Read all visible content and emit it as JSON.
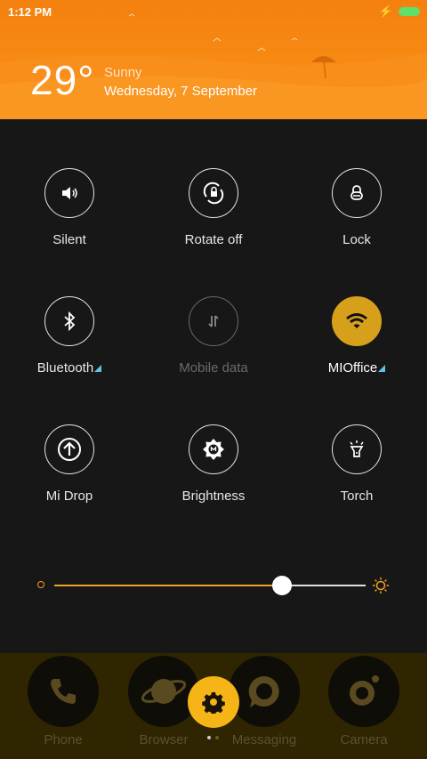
{
  "status_bar": {
    "time": "1:12 PM",
    "icons": [
      "charging-bolt-icon",
      "battery-icon"
    ]
  },
  "weather": {
    "temperature": "29°",
    "condition": "Sunny",
    "date": "Wednesday, 7 September"
  },
  "quick_toggles": [
    {
      "label": "Silent",
      "icon": "speaker-icon",
      "state": "off",
      "has_settings_corner": false
    },
    {
      "label": "Rotate off",
      "icon": "rotate-lock-icon",
      "state": "off",
      "has_settings_corner": false
    },
    {
      "label": "Lock",
      "icon": "lock-icon",
      "state": "off",
      "has_settings_corner": false
    },
    {
      "label": "Bluetooth",
      "icon": "bluetooth-icon",
      "state": "off",
      "has_settings_corner": true
    },
    {
      "label": "Mobile data",
      "icon": "mobile-data-icon",
      "state": "disabled",
      "has_settings_corner": false
    },
    {
      "label": "MIOffice",
      "icon": "wifi-icon",
      "state": "on",
      "has_settings_corner": true
    },
    {
      "label": "Mi Drop",
      "icon": "upload-icon",
      "state": "off",
      "has_settings_corner": false
    },
    {
      "label": "Brightness",
      "icon": "brightness-auto-icon",
      "state": "off",
      "has_settings_corner": false
    },
    {
      "label": "Torch",
      "icon": "torch-icon",
      "state": "off",
      "has_settings_corner": false
    }
  ],
  "brightness": {
    "level": 0.73,
    "min_icon": "brightness-low-icon",
    "max_icon": "brightness-high-icon"
  },
  "dock": {
    "apps": [
      {
        "label": "Phone",
        "icon": "phone-icon"
      },
      {
        "label": "Browser",
        "icon": "browser-icon"
      },
      {
        "label": "Messaging",
        "icon": "messaging-icon"
      },
      {
        "label": "Camera",
        "icon": "camera-icon"
      }
    ],
    "settings_icon": "gear-icon",
    "page_dots": 2,
    "active_page": 0
  },
  "colors": {
    "header": "#f68410",
    "active_toggle": "#d7a01b",
    "accent": "#f0a020",
    "corner_indicator": "#5ec3e6",
    "settings_button": "#f6b516",
    "battery": "#5ee06a"
  }
}
